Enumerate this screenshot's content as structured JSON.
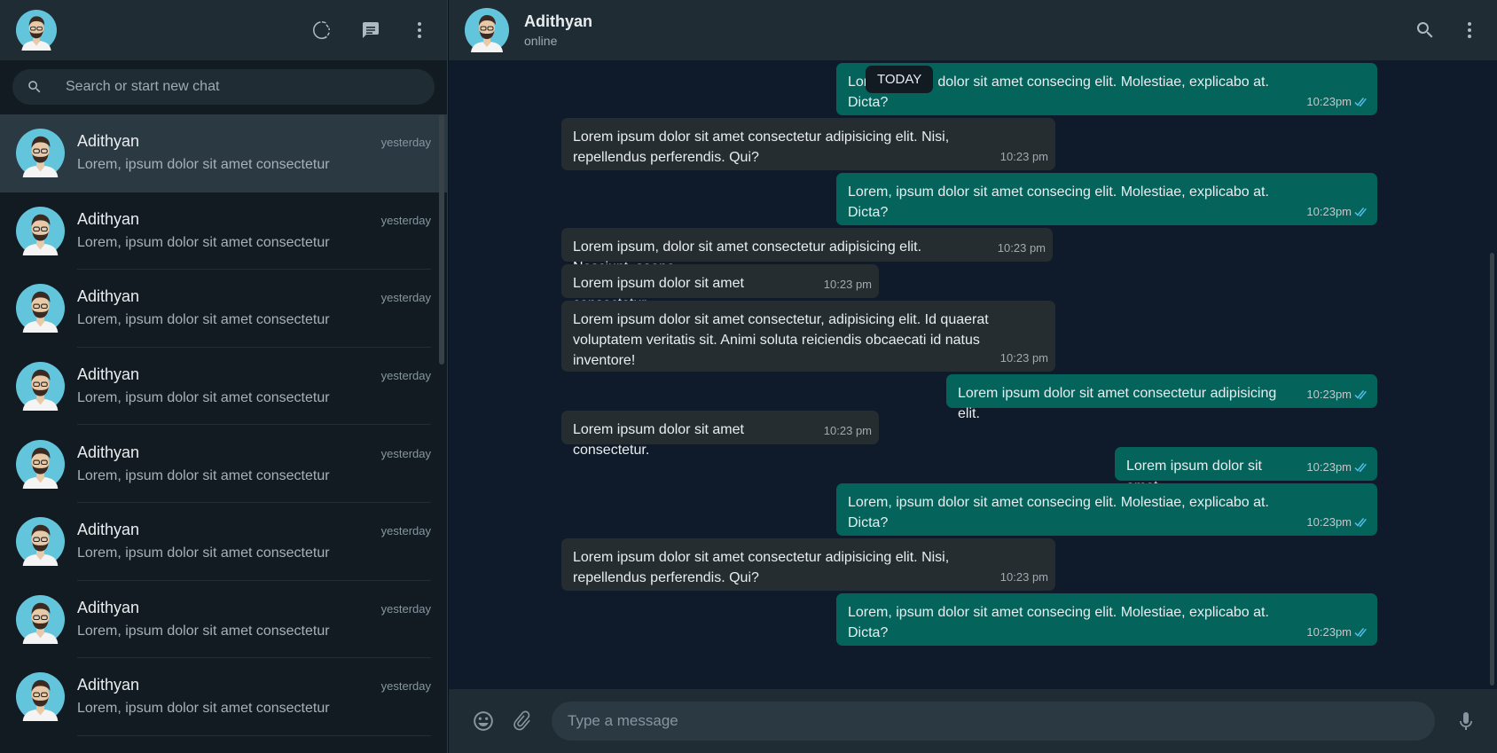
{
  "sidebar": {
    "search_placeholder": "Search or start new chat",
    "chats": [
      {
        "name": "Adithyan",
        "time": "yesterday",
        "preview": "Lorem, ipsum dolor sit amet consectetur",
        "active": true
      },
      {
        "name": "Adithyan",
        "time": "yesterday",
        "preview": "Lorem, ipsum dolor sit amet consectetur"
      },
      {
        "name": "Adithyan",
        "time": "yesterday",
        "preview": "Lorem, ipsum dolor sit amet consectetur"
      },
      {
        "name": "Adithyan",
        "time": "yesterday",
        "preview": "Lorem, ipsum dolor sit amet consectetur"
      },
      {
        "name": "Adithyan",
        "time": "yesterday",
        "preview": "Lorem, ipsum dolor sit amet consectetur"
      },
      {
        "name": "Adithyan",
        "time": "yesterday",
        "preview": "Lorem, ipsum dolor sit amet consectetur"
      },
      {
        "name": "Adithyan",
        "time": "yesterday",
        "preview": "Lorem, ipsum dolor sit amet consectetur"
      },
      {
        "name": "Adithyan",
        "time": "yesterday",
        "preview": "Lorem, ipsum dolor sit amet consectetur"
      }
    ]
  },
  "conversation": {
    "contact_name": "Adithyan",
    "contact_status": "online",
    "date_divider": "TODAY",
    "messages": [
      {
        "dir": "out",
        "text": "Lorem, ipsum dolor sit amet consecing elit. Molestiae, explicabo at. Dicta?",
        "time": "10:23pm"
      },
      {
        "dir": "in",
        "text": "Lorem ipsum dolor sit amet consectetur adipisicing elit. Nisi, repellendus perferendis. Qui?",
        "time": "10:23 pm"
      },
      {
        "dir": "out",
        "text": "Lorem, ipsum dolor sit amet consecing elit. Molestiae, explicabo at. Dicta?",
        "time": "10:23pm"
      },
      {
        "dir": "in",
        "text": "Lorem ipsum, dolor sit amet consectetur adipisicing elit. Nesciunt, saepe.",
        "time": "10:23 pm"
      },
      {
        "dir": "in",
        "text": "Lorem ipsum dolor sit amet consectetur.",
        "time": "10:23 pm"
      },
      {
        "dir": "in",
        "text": "Lorem ipsum dolor sit amet consectetur, adipisicing elit. Id quaerat voluptatem veritatis sit. Animi soluta reiciendis obcaecati id natus inventore!",
        "time": "10:23 pm"
      },
      {
        "dir": "out",
        "text": "Lorem ipsum dolor sit amet consectetur adipisicing elit.",
        "time": "10:23pm"
      },
      {
        "dir": "in",
        "text": "Lorem ipsum dolor sit amet consectetur.",
        "time": "10:23 pm"
      },
      {
        "dir": "out",
        "text": "Lorem ipsum dolor sit amet.",
        "time": "10:23pm"
      },
      {
        "dir": "out",
        "text": "Lorem, ipsum dolor sit amet consecing elit. Molestiae, explicabo at. Dicta?",
        "time": "10:23pm"
      },
      {
        "dir": "in",
        "text": "Lorem ipsum dolor sit amet consectetur adipisicing elit. Nisi, repellendus perferendis. Qui?",
        "time": "10:23 pm"
      },
      {
        "dir": "out",
        "text": "Lorem, ipsum dolor sit amet consecing elit. Molestiae, explicabo at. Dicta?",
        "time": "10:23pm"
      }
    ]
  },
  "composer": {
    "placeholder": "Type a message"
  },
  "icons": {
    "status": "status-ring-icon",
    "new_chat": "chat-bubble-icon",
    "menu": "vertical-dots-icon",
    "search": "search-icon",
    "emoji": "emoji-icon",
    "attach": "paperclip-icon",
    "mic": "microphone-icon",
    "read": "double-check-icon"
  },
  "colors": {
    "outgoing_bubble": "#04645c",
    "incoming_bubble": "#262d31",
    "read_tick": "#53bdeb",
    "header_bg": "#202c33"
  }
}
